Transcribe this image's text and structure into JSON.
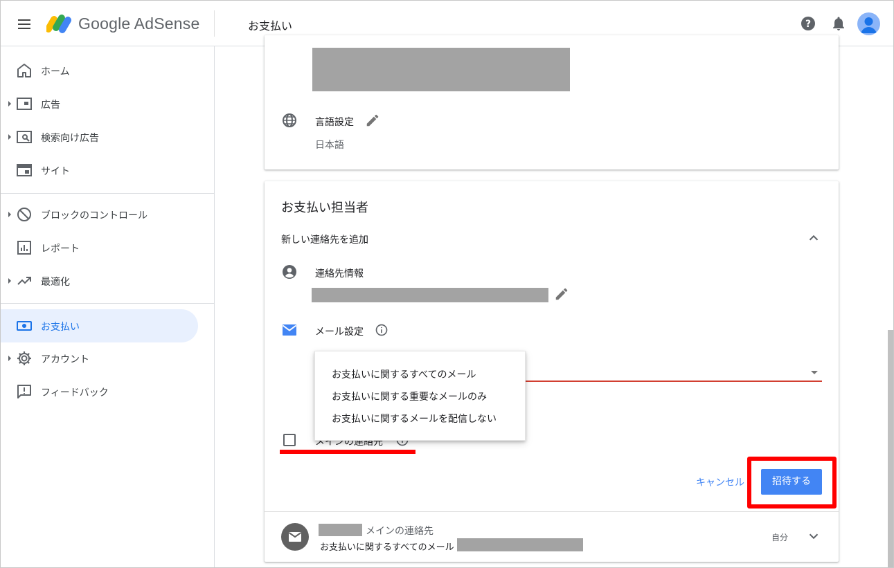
{
  "header": {
    "app_name": "Google AdSense",
    "page_title": "お支払い",
    "icons": [
      "menu-icon",
      "help-icon",
      "notifications-icon",
      "avatar"
    ]
  },
  "sidebar": {
    "items": [
      {
        "label": "ホーム",
        "icon": "home-icon",
        "expandable": false
      },
      {
        "label": "広告",
        "icon": "ads-icon",
        "expandable": true
      },
      {
        "label": "検索向け広告",
        "icon": "search-ads-icon",
        "expandable": true
      },
      {
        "label": "サイト",
        "icon": "sites-icon",
        "expandable": false
      },
      {
        "label": "ブロックのコントロール",
        "icon": "block-icon",
        "expandable": true
      },
      {
        "label": "レポート",
        "icon": "reports-icon",
        "expandable": false
      },
      {
        "label": "最適化",
        "icon": "optimization-icon",
        "expandable": true
      },
      {
        "label": "お支払い",
        "icon": "payments-icon",
        "expandable": false,
        "active": true
      },
      {
        "label": "アカウント",
        "icon": "account-gear-icon",
        "expandable": true
      },
      {
        "label": "フィードバック",
        "icon": "feedback-icon",
        "expandable": false
      }
    ]
  },
  "language_section": {
    "label": "言語設定",
    "value": "日本語"
  },
  "contacts_card": {
    "title": "お支払い担当者",
    "add_contact": "新しい連絡先を追加",
    "contact_info_label": "連絡先情報",
    "email_settings_label": "メール設定",
    "email_options": [
      "お支払いに関するすべてのメール",
      "お支払いに関する重要なメールのみ",
      "お支払いに関するメールを配信しない"
    ],
    "main_contact_checkbox_label": "メインの連絡先",
    "cancel_label": "キャンセル",
    "invite_label": "招待する"
  },
  "existing_contact": {
    "role": "メインの連絡先",
    "email_pref": "お支払いに関するすべてのメール",
    "owner": "自分"
  },
  "colors": {
    "accent": "#4285f4",
    "active_nav_bg": "#e8f0fe",
    "highlight_red": "#ff0000",
    "redaction": "#a3a3a3"
  }
}
